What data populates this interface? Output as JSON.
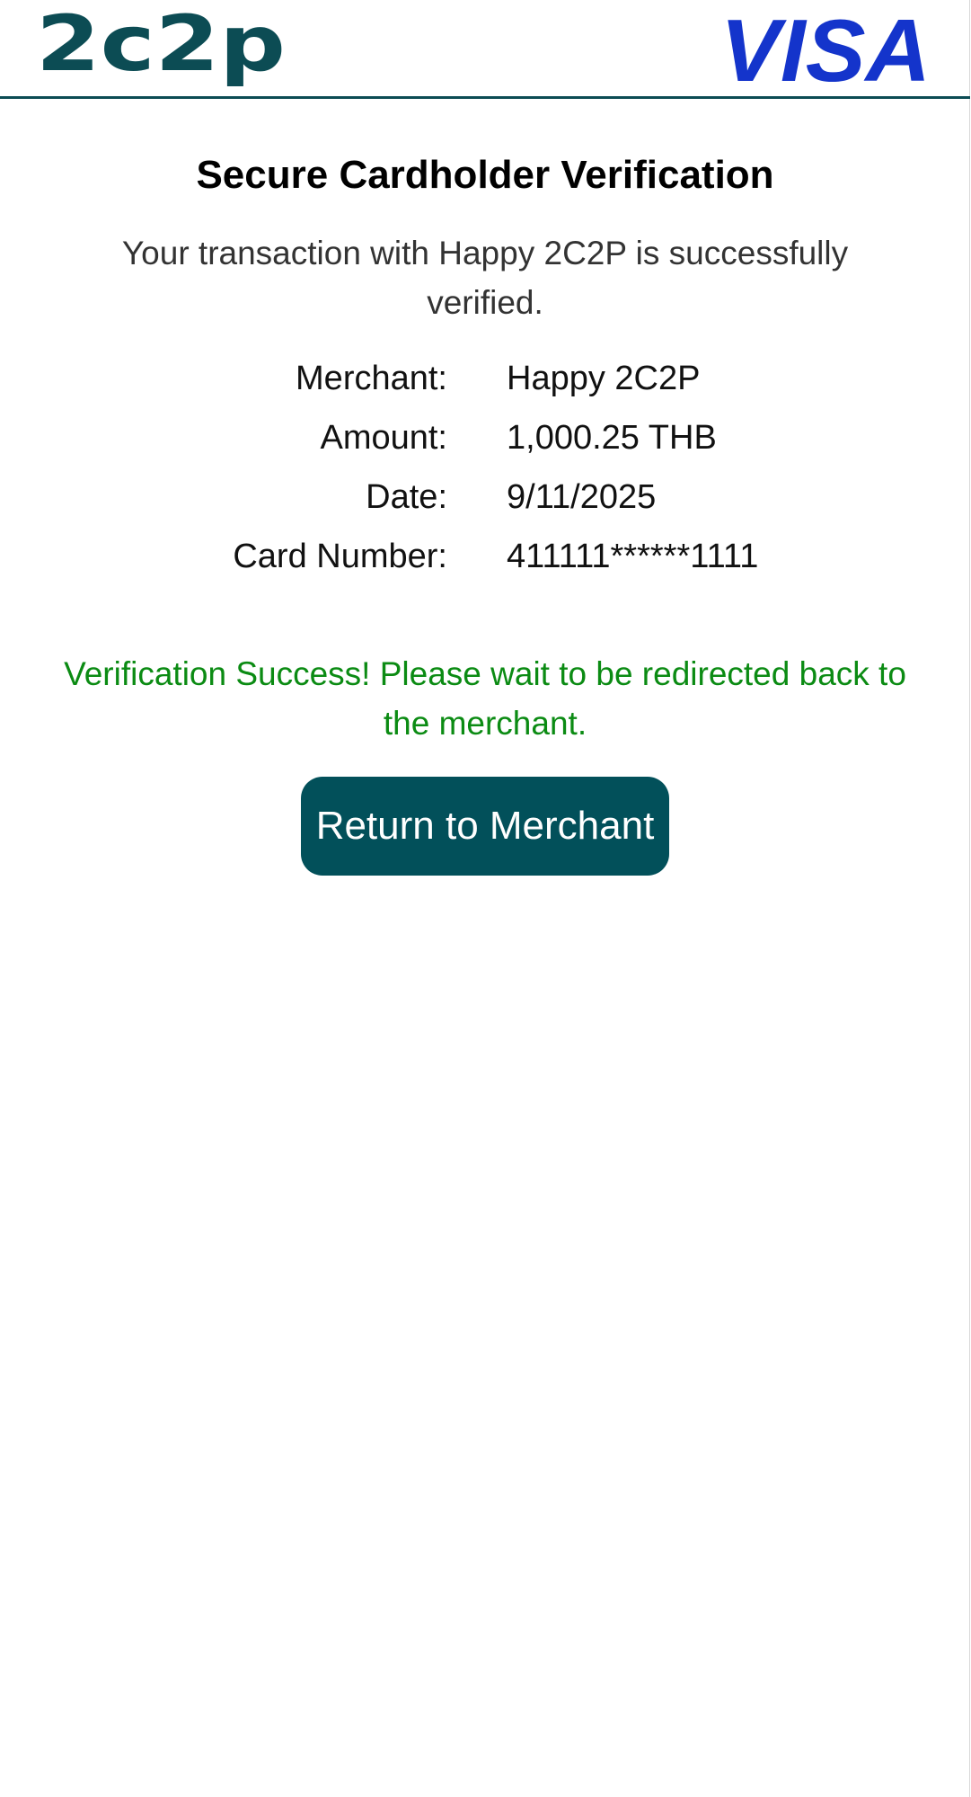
{
  "header": {
    "left_logo": {
      "text": "2c2p",
      "color": "#0c4c54",
      "icon": "2c2p-logo"
    },
    "right_logo": {
      "text": "VISA",
      "color": "#1434cb",
      "icon": "visa-logo"
    },
    "border_color": "#0c4c54"
  },
  "main": {
    "title": "Secure Cardholder Verification",
    "intro": "Your transaction with Happy 2C2P is successfully verified.",
    "details": [
      {
        "label": "Merchant:",
        "value": "Happy 2C2P"
      },
      {
        "label": "Amount:",
        "value": "1,000.25 THB"
      },
      {
        "label": "Date:",
        "value": "9/11/2025"
      },
      {
        "label": "Card Number:",
        "value": "411111******1111"
      }
    ],
    "success_message": "Verification Success! Please wait to be redirected back to the merchant.",
    "success_color": "#0b8b13",
    "button": {
      "label": "Return to Merchant",
      "color": "#02505a"
    }
  }
}
